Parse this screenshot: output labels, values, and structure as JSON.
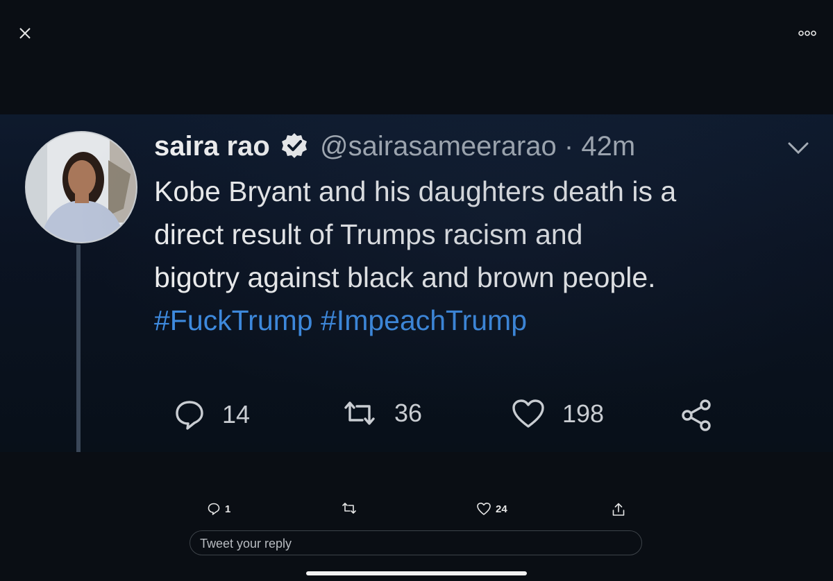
{
  "tweet": {
    "name": "saira rao",
    "handle": "@sairasameerarao",
    "separator": "·",
    "time": "42m",
    "lines": [
      "Kobe Bryant and his daughters death is a",
      "direct result of Trumps racism and",
      "bigotry against black and brown people."
    ],
    "hashtags": [
      "#FuckTrump",
      "#ImpeachTrump"
    ],
    "replies": "14",
    "retweets": "36",
    "likes": "198"
  },
  "bottom_bar": {
    "replies": "1",
    "likes": "24"
  },
  "reply_box": {
    "placeholder": "Tweet your reply"
  },
  "colors": {
    "background": "#0a0e14",
    "hashtag": "#3e8be0",
    "secondary_text": "#a9b0b8"
  },
  "icons": {
    "close": "close-icon",
    "more": "more-icon",
    "verified": "verified-badge-icon",
    "chevron": "chevron-down-icon",
    "reply": "reply-icon",
    "retweet": "retweet-icon",
    "like": "heart-icon",
    "share": "share-icon"
  }
}
